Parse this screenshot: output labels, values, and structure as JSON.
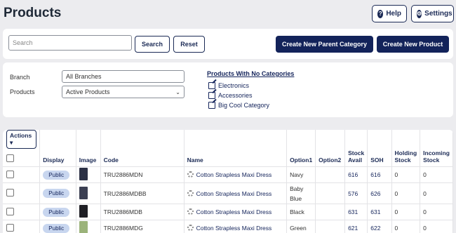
{
  "page": {
    "title": "Products"
  },
  "header": {
    "help_label": "Help",
    "settings_label": "Settings"
  },
  "search": {
    "placeholder": "Search",
    "value": "",
    "search_label": "Search",
    "reset_label": "Reset"
  },
  "actions": {
    "create_parent_category": "Create New Parent Category",
    "create_product": "Create New Product"
  },
  "filters": {
    "branch_label": "Branch",
    "branch_value": "All Branches",
    "products_label": "Products",
    "products_value": "Active Products"
  },
  "no_categories": {
    "title": "Products With No Categories",
    "items": [
      "Electronics",
      "Accessories",
      "Big Cool Category"
    ]
  },
  "table": {
    "actions_label": "Actions",
    "columns": [
      "Display",
      "Image",
      "Code",
      "Name",
      "Option1",
      "Option2",
      "Stock Avail",
      "SOH",
      "Holding Stock",
      "Incoming Stock"
    ],
    "rows": [
      {
        "display": "Public",
        "code": "TRU2886MDN",
        "name": "Cotton Strapless Maxi Dress",
        "option1": "Navy",
        "option2": "",
        "stock_avail": "616",
        "soh": "616",
        "holding": "0",
        "incoming": "0",
        "image_color": "#2c3145"
      },
      {
        "display": "Public",
        "code": "TRU2886MDBB",
        "name": "Cotton Strapless Maxi Dress",
        "option1": "Baby Blue",
        "option2": "",
        "stock_avail": "576",
        "soh": "626",
        "holding": "0",
        "incoming": "0",
        "image_color": "#3b3f52"
      },
      {
        "display": "Public",
        "code": "TRU2886MDB",
        "name": "Cotton Strapless Maxi Dress",
        "option1": "Black",
        "option2": "",
        "stock_avail": "631",
        "soh": "631",
        "holding": "0",
        "incoming": "0",
        "image_color": "#1e1e24"
      },
      {
        "display": "Public",
        "code": "TRU2886MDG",
        "name": "Cotton Strapless Maxi Dress",
        "option1": "Green",
        "option2": "",
        "stock_avail": "621",
        "soh": "622",
        "holding": "0",
        "incoming": "0",
        "image_color": "#9bb37a"
      }
    ]
  },
  "colors": {
    "primary": "#13235a",
    "badge": "#c8d6ef",
    "background": "#ececef"
  }
}
